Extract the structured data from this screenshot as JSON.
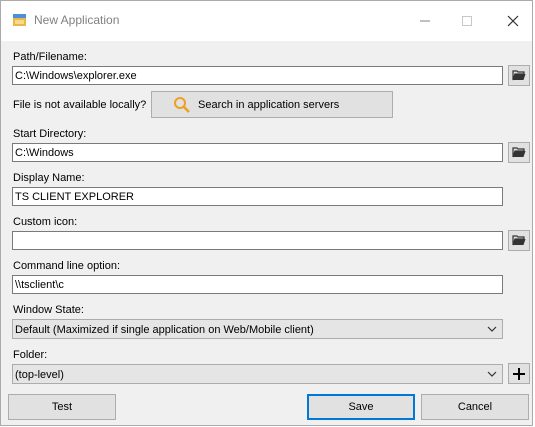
{
  "window": {
    "title": "New Application"
  },
  "path": {
    "label": "Path/Filename:",
    "value": "C:\\Windows\\explorer.exe"
  },
  "availability": {
    "label": "File is not available locally?",
    "search_button": "Search in application servers"
  },
  "start_directory": {
    "label": "Start Directory:",
    "value": "C:\\Windows"
  },
  "display_name": {
    "label": "Display Name:",
    "value": "TS CLIENT EXPLORER"
  },
  "custom_icon": {
    "label": "Custom icon:",
    "value": ""
  },
  "command_line": {
    "label": "Command line option:",
    "value": "\\\\tsclient\\c"
  },
  "window_state": {
    "label": "Window State:",
    "selected": "Default (Maximized if single application on Web/Mobile client)"
  },
  "folder": {
    "label": "Folder:",
    "selected": "(top-level)"
  },
  "buttons": {
    "test": "Test",
    "save": "Save",
    "cancel": "Cancel"
  },
  "colors": {
    "accent": "#0078d7",
    "search_icon": "#f0a020",
    "folder_icon": "#333333"
  },
  "icons": {
    "app": "app-icon",
    "browse": "folder-open-icon",
    "search": "search-icon",
    "dropdown": "chevron-down-icon",
    "add": "plus-icon"
  }
}
